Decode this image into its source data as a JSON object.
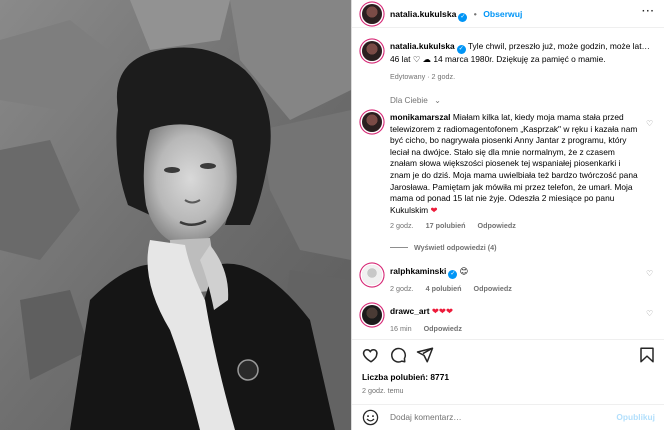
{
  "header": {
    "username": "natalia.kukulska",
    "separator": "•",
    "follow": "Obserwuj"
  },
  "caption": {
    "username": "natalia.kukulska",
    "text_part1": "Tyle chwil, przeszło już, może godzin, może lat… 46 lat",
    "text_part2": "14 marca 1980r. Dziękuję za pamięć o mamie.",
    "meta": "Edytowany · 2 godz."
  },
  "filter": {
    "label": "Dla Ciebie",
    "chevron": "⌄"
  },
  "comments": [
    {
      "username": "monikamarszal",
      "text": "Miałam kilka lat, kiedy moja mama stała przed telewizorem z radiomagentofonem „Kasprzak\" w ręku i kazała nam być cicho, bo nagrywała piosenki Anny Jantar z programu, który leciał na dwójce. Stało się dla mnie normalnym, że z czasem znałam słowa większości piosenek tej wspaniałej piosenkarki i znam je do dziś. Moja mama uwielbiała też bardzo twórczość pana Jarosława. Pamiętam jak mówiła mi przez telefon, że umarł. Moja mama od ponad 15 lat nie żyje. Odeszła 2 miesiące po panu Kukulskim",
      "time": "2 godz.",
      "likes": "17 polubień",
      "reply": "Odpowiedz",
      "view_replies": "Wyświetl odpowiedzi (4)"
    },
    {
      "username": "ralphkaminski",
      "text": "😊",
      "time": "2 godz.",
      "likes": "4 polubień",
      "reply": "Odpowiedz"
    },
    {
      "username": "drawc_art",
      "text": "❤❤❤",
      "time": "16 min",
      "reply": "Odpowiedz"
    }
  ],
  "stats": {
    "likes_label": "Liczba polubień: 8771",
    "time": "2 godz. temu"
  },
  "add_comment": {
    "placeholder": "Dodaj komentarz…",
    "publish": "Opublikuj"
  },
  "colors": {
    "accent": "#0095f6",
    "heart_red": "#ed1b3a",
    "muted": "#737373"
  },
  "icons": [
    "heart-icon",
    "comment-icon",
    "share-icon",
    "bookmark-icon",
    "emoji-icon",
    "more-icon",
    "verified-icon",
    "like-icon"
  ]
}
